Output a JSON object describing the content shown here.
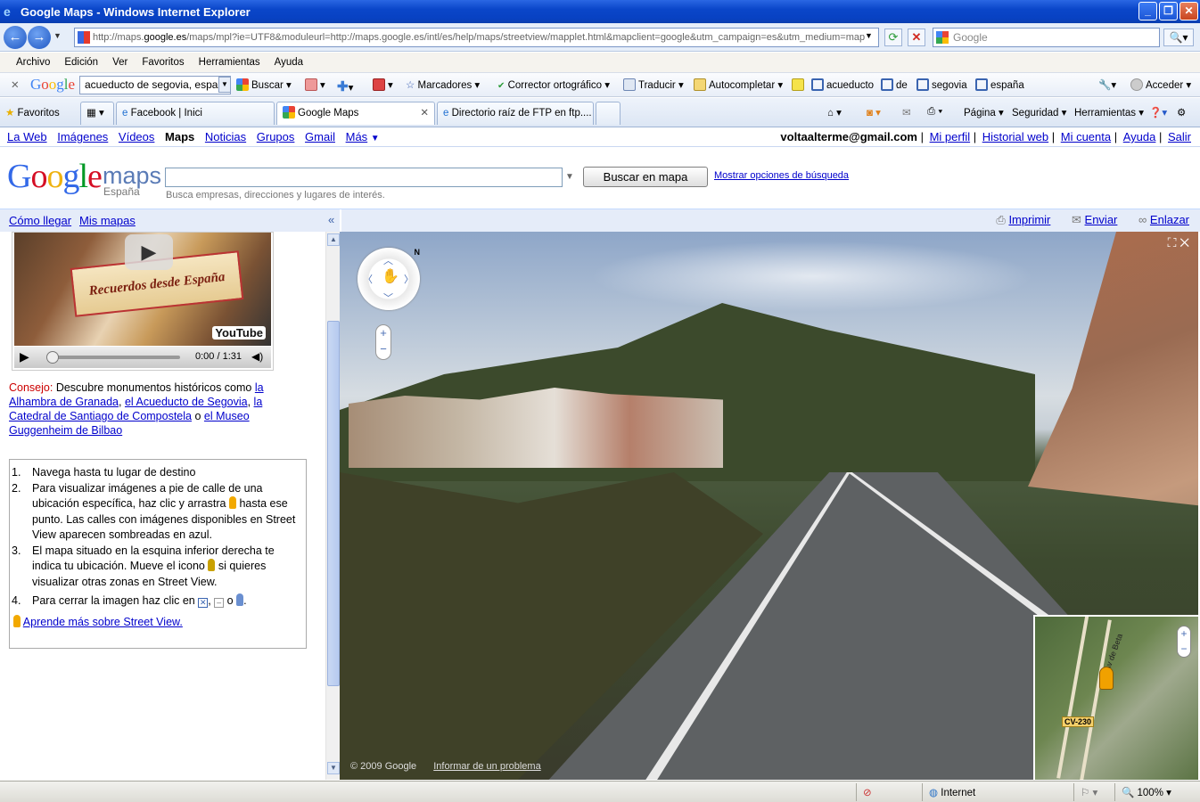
{
  "window": {
    "title": "Google Maps - Windows Internet Explorer"
  },
  "address": {
    "url_prefix": "http://maps.",
    "url_host": "google.es",
    "url_rest": "/maps/mpl?ie=UTF8&moduleurl=http://maps.google.es/intl/es/help/maps/streetview/mapplet.html&mapclient=google&utm_campaign=es&utm_medium=map",
    "search_placeholder": "Google"
  },
  "menu": [
    "Archivo",
    "Edición",
    "Ver",
    "Favoritos",
    "Herramientas",
    "Ayuda"
  ],
  "google_toolbar": {
    "logo": "Google",
    "query": "acueducto de segovia, españa",
    "buscar": "Buscar",
    "marcadores": "Marcadores",
    "corrector": "Corrector ortográfico",
    "traducir": "Traducir",
    "autocompletar": "Autocompletar",
    "terms": [
      "acueducto",
      "de",
      "segovia",
      "españa"
    ],
    "acceder": "Acceder"
  },
  "favorites_bar": {
    "favoritos": "Favoritos",
    "tabs": [
      "Facebook | Inici",
      "Google Maps",
      "Directorio raíz de FTP en ftp...."
    ],
    "commands": [
      "Página",
      "Seguridad",
      "Herramientas"
    ]
  },
  "gbar": {
    "links": [
      "La Web",
      "Imágenes",
      "Vídeos",
      "Maps",
      "Noticias",
      "Grupos",
      "Gmail",
      "Más"
    ],
    "email": "voltaalterme@gmail.com",
    "right_links": [
      "Mi perfil",
      "Historial web",
      "Mi cuenta",
      "Ayuda",
      "Salir"
    ]
  },
  "header": {
    "logo_google": "Google",
    "logo_maps": "maps",
    "logo_country": "España",
    "search_button": "Buscar en mapa",
    "search_options": "Mostrar opciones de búsqueda",
    "search_hint": "Busca empresas, direcciones y lugares de interés."
  },
  "panelbar": {
    "como_llegar": "Cómo llegar",
    "mis_mapas": "Mis mapas",
    "imprimir": "Imprimir",
    "enviar": "Enviar",
    "enlazar": "Enlazar"
  },
  "video": {
    "caption": "Recuerdos desde España",
    "brand": "YouTube",
    "time": "0:00 / 1:31"
  },
  "tip": {
    "label": "Consejo:",
    "text": "Descubre monumentos históricos como",
    "link1": "la Alhambra de Granada",
    "sep1": ",",
    "link2": "el Acueducto de Segovia",
    "sep2": ",",
    "link3": "la Catedral de Santiago de Compostela",
    "sep3": "o",
    "link4": "el Museo Guggenheim de Bilbao"
  },
  "steps": {
    "s1_num": "1.",
    "s1": "Navega hasta tu lugar de destino",
    "s2_num": "2.",
    "s2a": "Para visualizar imágenes a pie de calle de una ubicación específica, haz clic y arrastra",
    "s2b": "hasta ese punto. Las calles con imágenes disponibles en Street View aparecen sombreadas en azul.",
    "s3_num": "3.",
    "s3a": "El mapa situado en la esquina inferior derecha te indica tu ubicación. Mueve el icono",
    "s3b": "si quieres visualizar otras zonas en Street View.",
    "s4_num": "4.",
    "s4a": "Para cerrar la imagen haz clic en",
    "s4b": ",",
    "s4c": "o",
    "s4d": ".",
    "learn": "Aprende más sobre Street View."
  },
  "streetview": {
    "copyright": "© 2009 Google",
    "report": "Informar de un problema",
    "compass_n": "N",
    "minimap_road": "CV-230",
    "minimap_street": "Av de Beta"
  },
  "status": {
    "zone": "Internet",
    "zoom": "100%"
  }
}
